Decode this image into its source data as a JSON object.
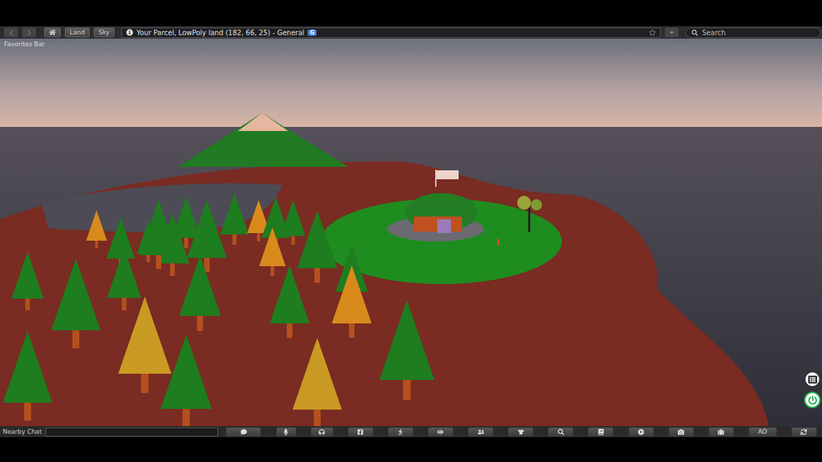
{
  "nav": {
    "back_enabled": false,
    "forward_enabled": false,
    "buttons": [
      {
        "label": "Land"
      },
      {
        "label": "Sky"
      }
    ],
    "location": "Your Parcel, LowPoly land (182, 66, 25) - General",
    "rating": "G",
    "favorite": false,
    "search_placeholder": "Search"
  },
  "favorites_bar": {
    "label": "Favorites Bar"
  },
  "chat": {
    "label": "Nearby Chat",
    "value": ""
  },
  "toolbar": {
    "text_buttons": [
      "AO"
    ]
  }
}
